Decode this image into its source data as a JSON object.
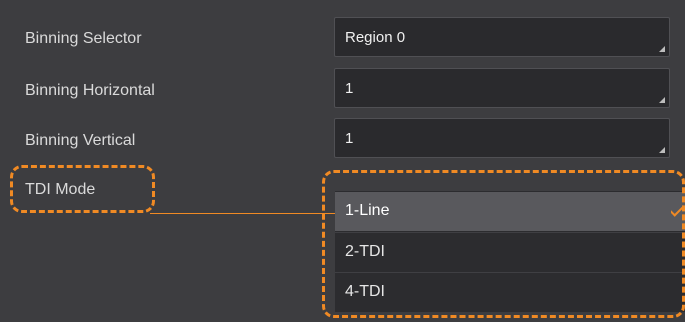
{
  "properties": [
    {
      "label": "Binning Selector",
      "value": "Region 0"
    },
    {
      "label": "Binning Horizontal",
      "value": "1"
    },
    {
      "label": "Binning Vertical",
      "value": "1"
    }
  ],
  "tdi": {
    "label": "TDI Mode",
    "selected_value": "1-Line",
    "options": [
      "1-Line",
      "2-TDI",
      "4-TDI"
    ]
  },
  "colors": {
    "panel_bg": "#3d3d40",
    "field_bg": "#2a2a2d",
    "accent": "#f08a24",
    "selected_option_bg": "#59595d"
  },
  "icons": {
    "dropdown_corner": "dropdown-corner-icon",
    "selected_mark": "checkmark-icon"
  }
}
